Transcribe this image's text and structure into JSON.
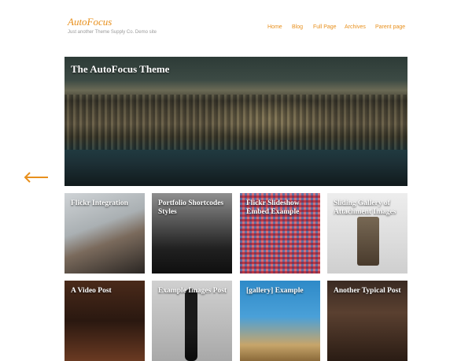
{
  "site": {
    "title": "AutoFocus",
    "tagline": "Just another Theme Supply Co. Demo site"
  },
  "nav": {
    "items": [
      "Home",
      "Blog",
      "Full Page",
      "Archives",
      "Parent page"
    ]
  },
  "hero": {
    "title": "The AutoFocus Theme"
  },
  "tiles": [
    {
      "title": "Flickr Integration"
    },
    {
      "title": "Portfolio Shortcodes Styles"
    },
    {
      "title": "Flickr Slideshow Embed Example"
    },
    {
      "title": "Sliding Gallery of Attachment Images"
    },
    {
      "title": "A Video Post"
    },
    {
      "title": "Example Images Post"
    },
    {
      "title": "[gallery] Example"
    },
    {
      "title": "Another Typical Post"
    }
  ],
  "colors": {
    "accent": "#e8901d",
    "tagline": "#9a9a9a",
    "background": "#ffffff"
  },
  "icons": {
    "previous": "arrow-left-icon"
  }
}
